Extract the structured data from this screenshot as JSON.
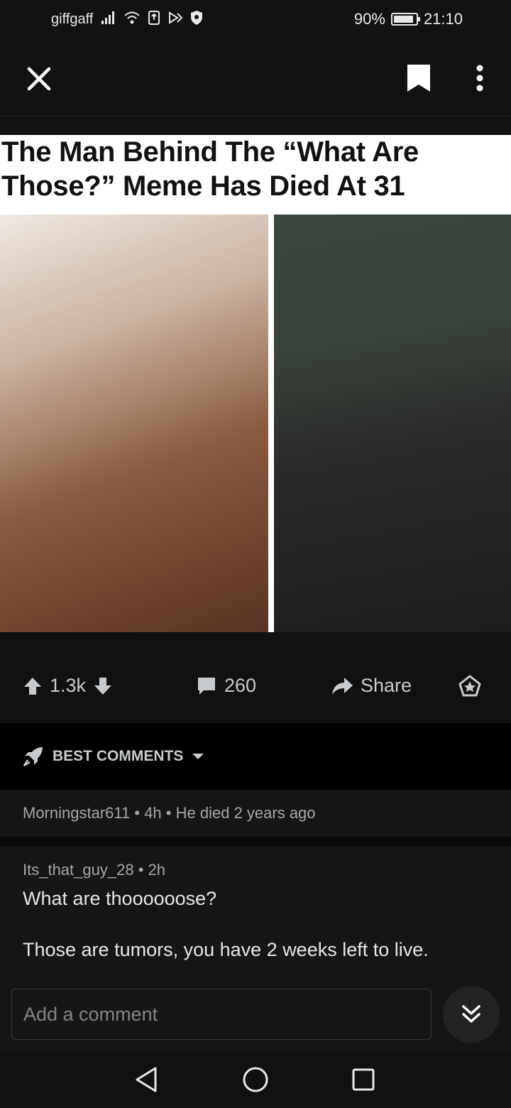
{
  "status_bar": {
    "carrier": "giffgaff",
    "battery": "90%",
    "battery_level": 0.9,
    "time": "21:10",
    "icons": [
      "signal-icon",
      "wifi-icon",
      "nfc-icon",
      "cast-icon",
      "shield-icon"
    ]
  },
  "toolbar": {
    "close_icon": "close-icon",
    "save_icon": "bookmark-icon",
    "more_icon": "more-vertical-icon"
  },
  "post": {
    "media_caption": "The Man Behind The “What Are Those?” Meme Has Died At 31",
    "upvotes": "1.3k",
    "comments_count": "260",
    "share_label": "Share"
  },
  "sort": {
    "label": "BEST COMMENTS"
  },
  "comments": [
    {
      "author": "Morningstar611",
      "age": "4h",
      "body": "He died 2 years ago"
    },
    {
      "author": "Its_that_guy_28",
      "age": "2h",
      "body_lines": [
        "What are thoooooose?",
        "Those are tumors, you have 2 weeks left to live."
      ]
    }
  ],
  "composer": {
    "placeholder": "Add a comment"
  },
  "colors": {
    "background": "#111111",
    "card": "#161616",
    "text": "#d7dadc",
    "muted": "#a3a6a8"
  }
}
